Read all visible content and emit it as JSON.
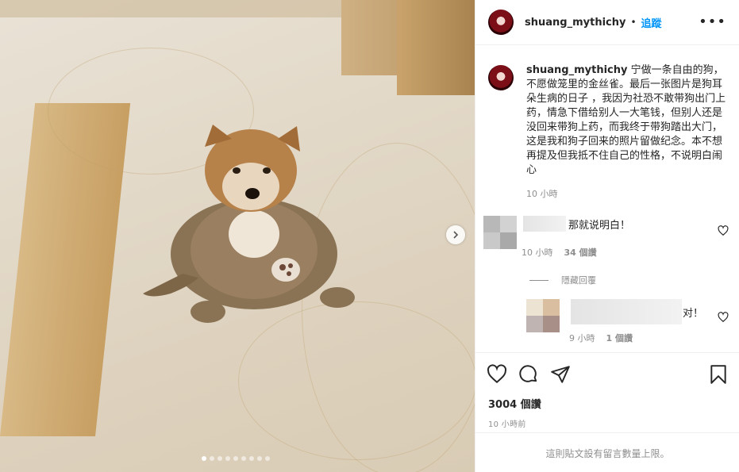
{
  "post": {
    "username": "shuang_mythichy",
    "follow_label": "追蹤",
    "bullet": "•",
    "more_label": "•••",
    "caption_text": "宁做一条自由的狗，不愿做笼里的金丝雀。最后一张图片是狗耳朵生病的日子 ，我因为社恐不敢带狗出门上药，情急下借给别人一大笔钱，但别人还是没回来带狗上药，而我终于带狗踏出大门，这是我和狗子回来的照片留做纪念。本不想再提及但我抵不住自己的性格，不说明白闹心",
    "caption_time": "10 小時"
  },
  "comments": [
    {
      "text": "那就说明白！",
      "time": "10 小時",
      "likes": "34 個讚",
      "hide_replies": "隱藏回覆"
    },
    {
      "text": "对！",
      "time": "9 小時",
      "likes": "1 個讚"
    }
  ],
  "footer": {
    "likes_count": "3004 個讚",
    "posted_time": "10 小時前",
    "comment_limit": "這則貼文設有留言數量上限。"
  },
  "carousel": {
    "dot_count": 9,
    "active_index": 0
  },
  "icons": [
    "more-options-icon",
    "chevron-right-icon",
    "heart-icon",
    "comment-icon",
    "share-icon",
    "bookmark-icon"
  ],
  "colors": {
    "accent": "#0095f6",
    "muted": "#8e8e8e",
    "text": "#262626"
  }
}
